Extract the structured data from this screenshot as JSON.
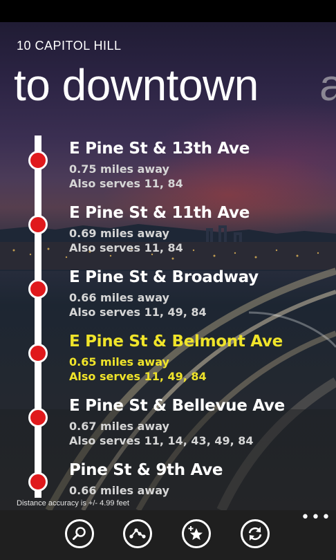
{
  "header": {
    "route_line": "10 CAPITOL HILL",
    "direction": "to downtown",
    "next_pivot_peek": "a"
  },
  "stops": [
    {
      "name": "E Pine St & 13th Ave",
      "distance": "0.75 miles away",
      "serves": "Also serves 11, 84",
      "highlighted": false
    },
    {
      "name": "E Pine St & 11th Ave",
      "distance": "0.69 miles away",
      "serves": "Also serves 11, 84",
      "highlighted": false
    },
    {
      "name": "E Pine St & Broadway",
      "distance": "0.66 miles away",
      "serves": "Also serves 11, 49, 84",
      "highlighted": false
    },
    {
      "name": "E Pine St & Belmont Ave",
      "distance": "0.65 miles away",
      "serves": "Also serves 11, 49, 84",
      "highlighted": true
    },
    {
      "name": "E Pine St & Bellevue Ave",
      "distance": "0.67 miles away",
      "serves": "Also serves 11, 14, 43, 49, 84",
      "highlighted": false
    },
    {
      "name": "Pine St & 9th Ave",
      "distance": "0.66 miles away",
      "serves": "",
      "highlighted": false
    }
  ],
  "footer": {
    "accuracy": "Distance accuracy is +/- 4.99 feet"
  },
  "app_bar": {
    "buttons": [
      "search-icon",
      "route-icon",
      "add-favorite-icon",
      "refresh-icon"
    ],
    "more": "•••"
  },
  "colors": {
    "stop_dot": "#e0191c",
    "highlight": "#f0e42a",
    "app_bar": "#1f1f1f"
  }
}
